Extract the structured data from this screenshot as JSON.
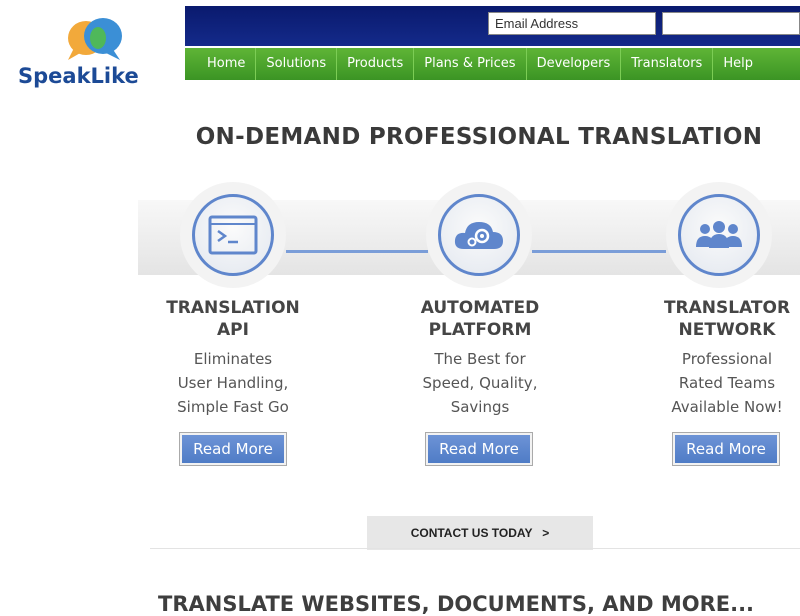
{
  "brand": {
    "name": "SpeakLike"
  },
  "login": {
    "email_placeholder": "Email Address"
  },
  "nav": {
    "items": [
      "Home",
      "Solutions",
      "Products",
      "Plans & Prices",
      "Developers",
      "Translators",
      "Help"
    ]
  },
  "hero": {
    "headline": "ON-DEMAND PROFESSIONAL TRANSLATION"
  },
  "features": [
    {
      "title1": "TRANSLATION",
      "title2": "API",
      "desc": [
        "Eliminates",
        "User Handling,",
        "Simple Fast Go"
      ],
      "button": "Read More",
      "icon": "terminal-icon"
    },
    {
      "title1": "AUTOMATED",
      "title2": "PLATFORM",
      "desc": [
        "The Best for",
        "Speed, Quality,",
        "Savings"
      ],
      "button": "Read More",
      "icon": "cloud-gear-icon"
    },
    {
      "title1": "TRANSLATOR",
      "title2": "NETWORK",
      "desc": [
        "Professional",
        "Rated Teams",
        "Available Now!"
      ],
      "button": "Read More",
      "icon": "people-icon"
    }
  ],
  "contact": {
    "label": "CONTACT US TODAY",
    "arrow": ">"
  },
  "section": {
    "title": "TRANSLATE WEBSITES, DOCUMENTS, AND MORE..."
  },
  "colors": {
    "nav_green": "#4aa52c",
    "header_navy": "#0f2278",
    "accent_blue": "#5f86cc"
  }
}
